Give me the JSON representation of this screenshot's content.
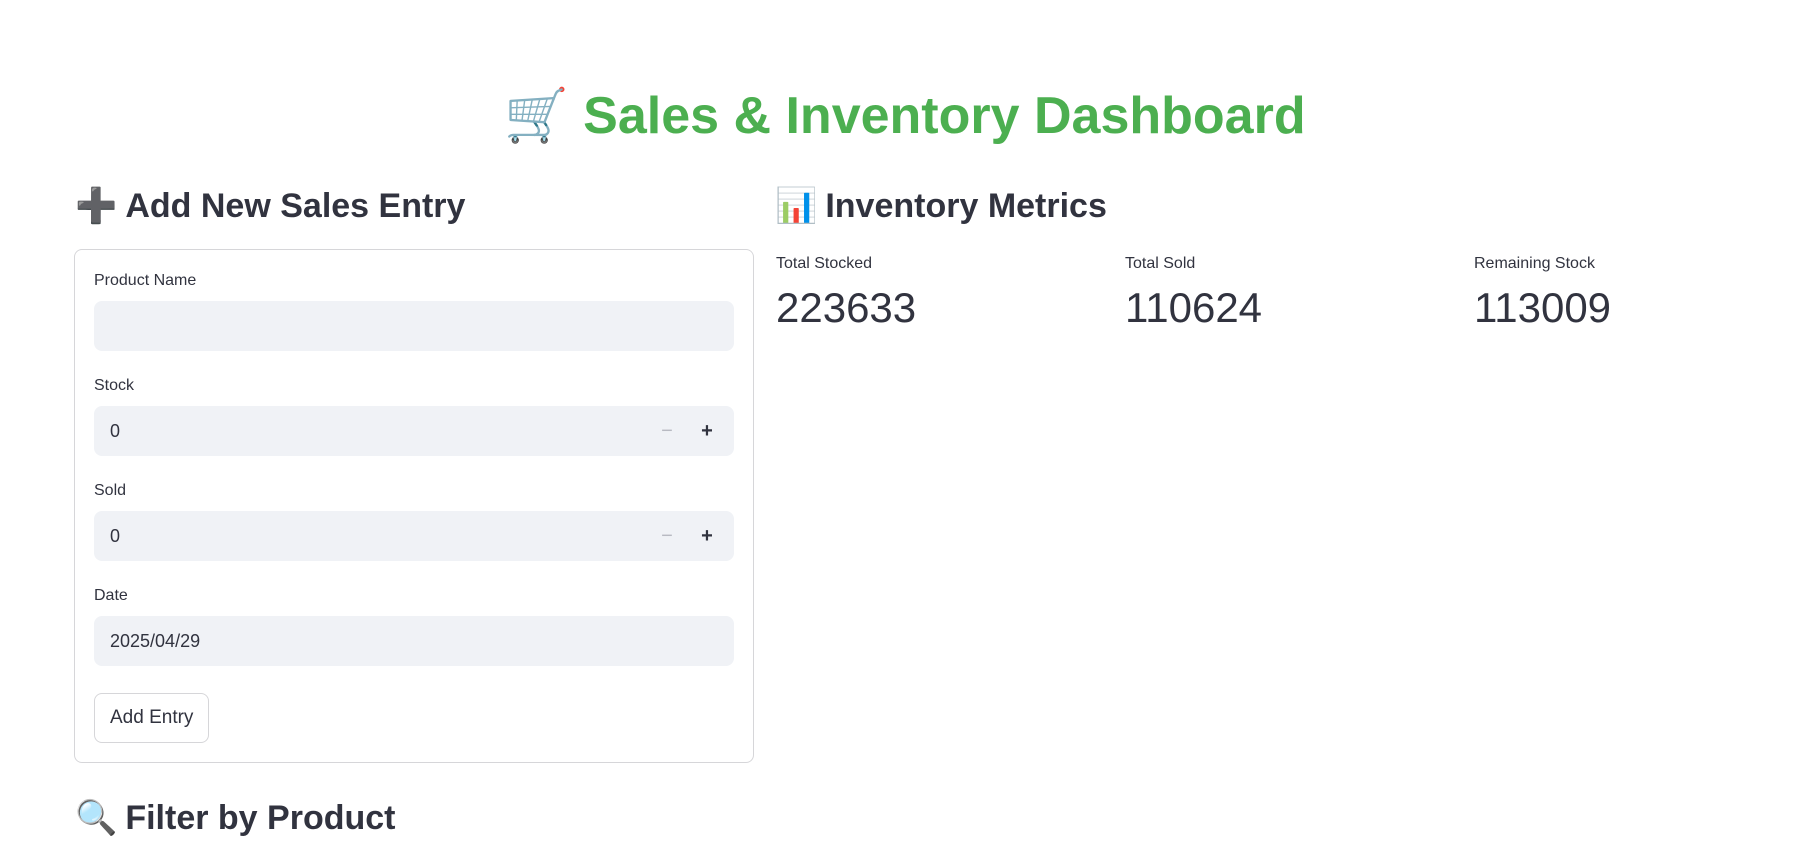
{
  "header": {
    "icon": "shopping-cart-icon",
    "icon_glyph": "🛒",
    "title": "Sales & Inventory Dashboard"
  },
  "add_section": {
    "icon": "plus-icon",
    "icon_glyph": "➕",
    "heading": "Add New Sales Entry",
    "fields": {
      "product_name": {
        "label": "Product Name",
        "value": ""
      },
      "stock": {
        "label": "Stock",
        "value": "0",
        "minus": "−",
        "plus": "+"
      },
      "sold": {
        "label": "Sold",
        "value": "0",
        "minus": "−",
        "plus": "+"
      },
      "date": {
        "label": "Date",
        "value": "2025/04/29"
      }
    },
    "button_label": "Add Entry"
  },
  "metrics_section": {
    "icon": "bar-chart-icon",
    "icon_glyph": "📊",
    "heading": "Inventory Metrics",
    "items": [
      {
        "label": "Total Stocked",
        "value": "223633"
      },
      {
        "label": "Total Sold",
        "value": "110624"
      },
      {
        "label": "Remaining Stock",
        "value": "113009"
      }
    ]
  },
  "filter_section": {
    "icon": "magnifier-icon",
    "icon_glyph": "🔍",
    "heading": "Filter by Product"
  },
  "colors": {
    "title": "#4caf50",
    "text": "#31333f",
    "input_bg": "#f0f2f6",
    "border": "#d6d6d9"
  }
}
